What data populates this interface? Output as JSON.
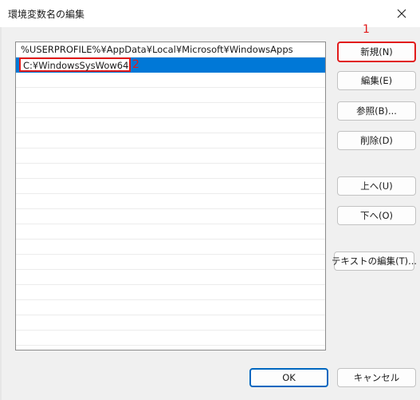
{
  "window": {
    "title": "環境変数名の編集"
  },
  "list": {
    "items": [
      {
        "text": "%USERPROFILE%¥AppData¥Local¥Microsoft¥WindowsApps"
      },
      {
        "text": "C:¥WindowsSysWow64"
      }
    ]
  },
  "buttons": {
    "new": "新規(N)",
    "edit": "編集(E)",
    "browse": "参照(B)...",
    "delete": "削除(D)",
    "up": "上へ(U)",
    "down": "下へ(O)",
    "edit_text": "テキストの編集(T)...",
    "ok": "OK",
    "cancel": "キャンセル"
  },
  "annotations": {
    "one": "1",
    "two": "2"
  },
  "colors": {
    "selection": "#0078d7",
    "annotation": "#e11a1a",
    "ok_border": "#0067c0"
  },
  "icons": {
    "close": "close-icon"
  }
}
